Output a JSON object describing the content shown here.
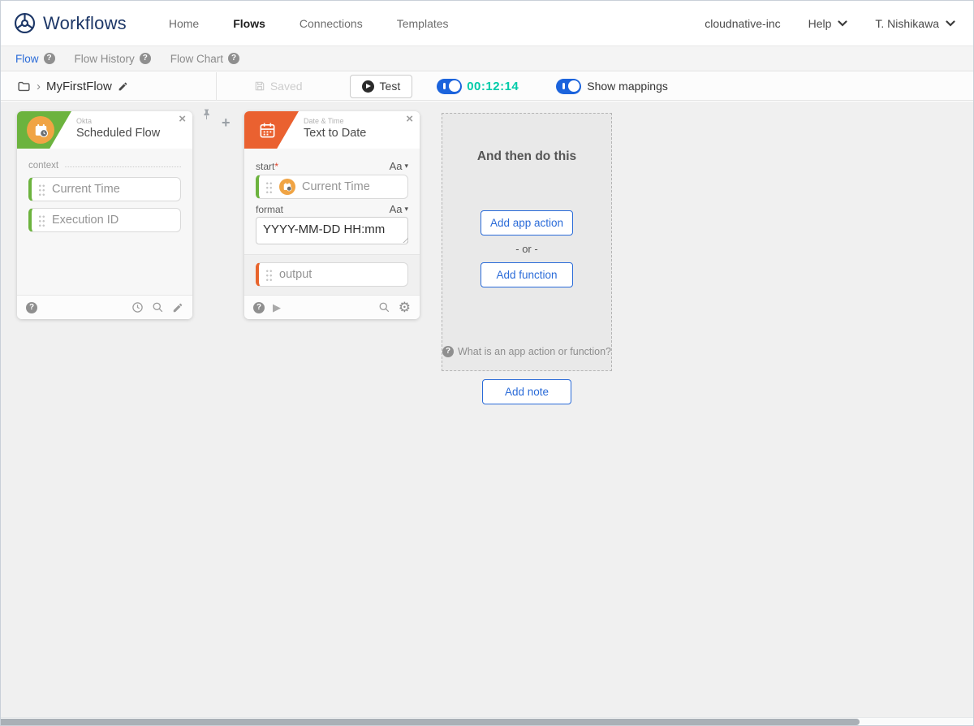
{
  "header": {
    "brand": "Workflows",
    "nav": [
      {
        "label": "Home"
      },
      {
        "label": "Flows"
      },
      {
        "label": "Connections"
      },
      {
        "label": "Templates"
      }
    ],
    "org": "cloudnative-inc",
    "help_label": "Help",
    "user": "T. Nishikawa"
  },
  "subnav": {
    "tabs": [
      {
        "label": "Flow"
      },
      {
        "label": "Flow History"
      },
      {
        "label": "Flow Chart"
      }
    ]
  },
  "toolbar": {
    "flow_name": "MyFirstFlow",
    "saved_label": "Saved",
    "test_label": "Test",
    "timer_value": "00:12:14",
    "show_mappings_label": "Show mappings"
  },
  "cards": {
    "trigger": {
      "app_label": "Okta",
      "title": "Scheduled Flow",
      "context_label": "context",
      "outputs": [
        {
          "label": "Current Time"
        },
        {
          "label": "Execution ID"
        }
      ]
    },
    "transform": {
      "category_label": "Date & Time",
      "title": "Text to Date",
      "start_label": "start",
      "required_marker": "*",
      "type_selector": "Aa",
      "start_value": "Current Time",
      "format_label": "format",
      "format_value": "YYYY-MM-DD HH:mm",
      "output_value": "output"
    }
  },
  "dropzone": {
    "title": "And then do this",
    "add_app_action_label": "Add app action",
    "or_label": "- or -",
    "add_function_label": "Add function",
    "help_text": "What is an app action or function?"
  },
  "add_note_label": "Add note",
  "icons": {
    "close": "×",
    "plus": "+",
    "play": "▶",
    "gear": "⚙",
    "caret": "▾",
    "chevron": "›",
    "question": "?"
  },
  "colors": {
    "accent_blue": "#2a6bd8",
    "toggle_blue": "#1b63dc",
    "timer_green": "#00cba9",
    "okta_green": "#6cb33e",
    "datetime_orange": "#ea6130",
    "okta_icon_orange": "#f0a444",
    "output_orange": "#e8642c"
  }
}
